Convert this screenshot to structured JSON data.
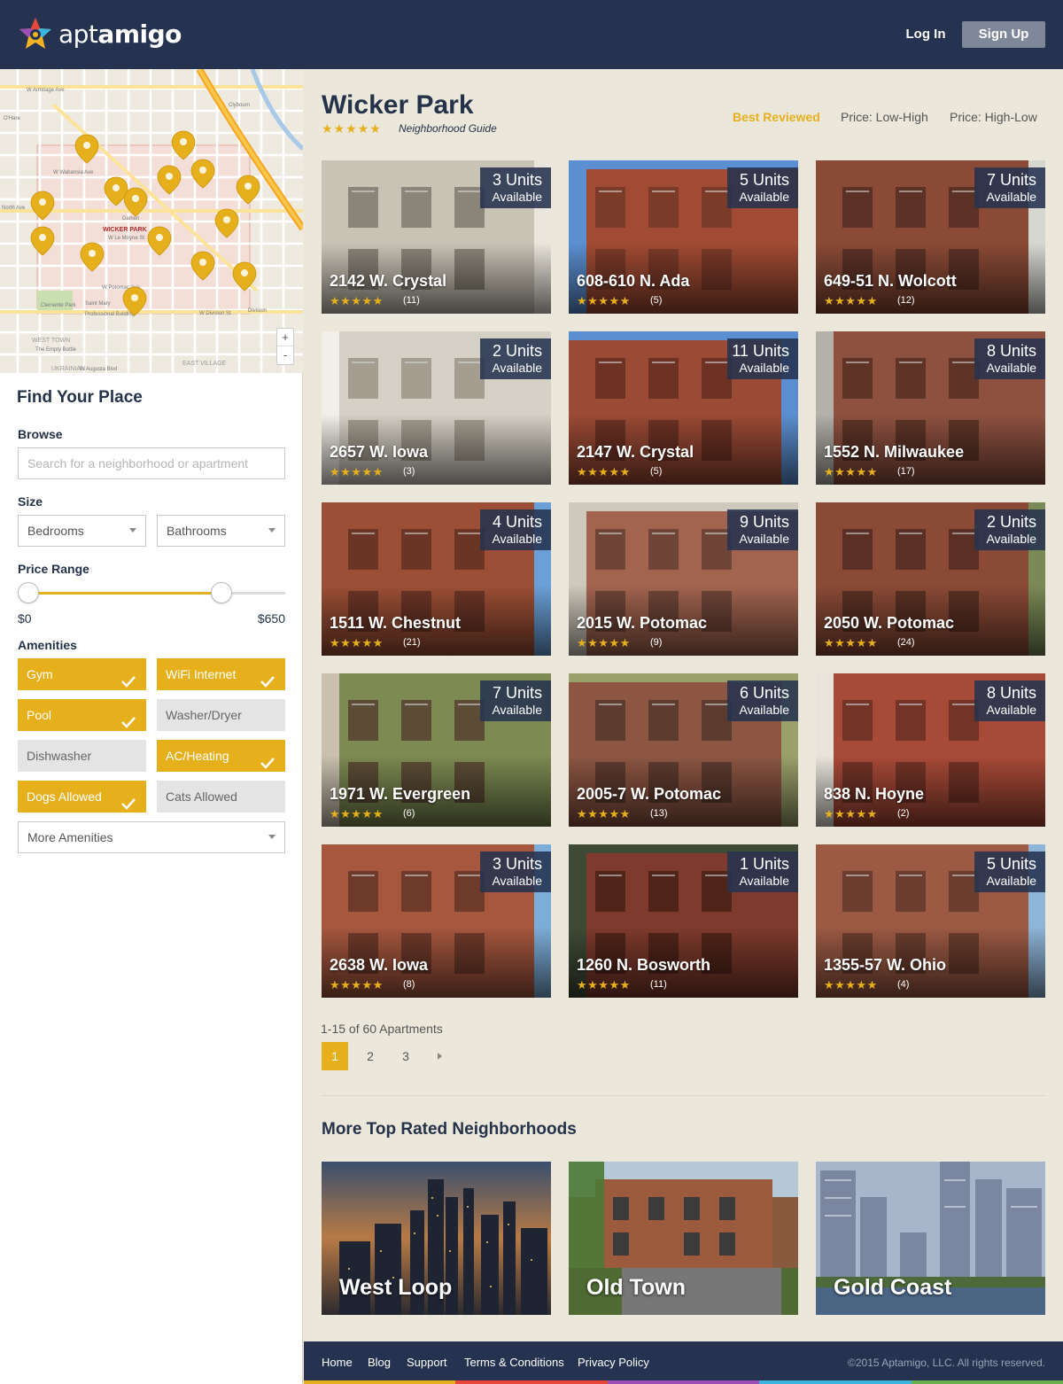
{
  "header": {
    "brand_part1": "apt",
    "brand_part2": "amigo",
    "login_label": "Log In",
    "signup_label": "Sign Up"
  },
  "sidebar": {
    "title": "Find Your Place",
    "browse_label": "Browse",
    "search_placeholder": "Search for a neighborhood or apartment",
    "size_label": "Size",
    "bedrooms_label": "Bedrooms",
    "bathrooms_label": "Bathrooms",
    "price_label": "Price Range",
    "price_min": "$0",
    "price_max": "$650",
    "price_range_selected_fraction": [
      0.04,
      0.76
    ],
    "amenities_label": "Amenities",
    "amenities": [
      {
        "label": "Gym",
        "checked": true
      },
      {
        "label": "WiFi Internet",
        "checked": true
      },
      {
        "label": "Pool",
        "checked": true
      },
      {
        "label": "Washer/Dryer",
        "checked": false
      },
      {
        "label": "Dishwasher",
        "checked": false
      },
      {
        "label": "AC/Heating",
        "checked": true
      },
      {
        "label": "Dogs Allowed",
        "checked": true
      },
      {
        "label": "Cats Allowed",
        "checked": false
      }
    ],
    "more_amenities_label": "More Amenities",
    "map": {
      "zoom_in": "+",
      "zoom_out": "-",
      "labels": {
        "wicker_park": "WICKER PARK",
        "west_town": "WEST TOWN",
        "east_village": "EAST VILLAGE",
        "ukrainian": "UKRAINIAN",
        "north_ave": "North Ave",
        "division": "Division",
        "armitage": "W Armitage Ave",
        "augusta": "W Augusta Blvd",
        "division_st": "W Division St",
        "potomac": "W Potomac Ave",
        "wabansia": "W Wabansia Ave",
        "le_moyne": "W Le Moyne St",
        "clybourn": "Clybourn",
        "ohare": "O'Hare",
        "damen": "Damen",
        "saint_mary": "Saint Mary",
        "professional_building": "Professional Building",
        "clemente_park": "Clemente Park",
        "the_empty_bottle": "The Empty Bottle"
      }
    }
  },
  "main": {
    "neighborhood": "Wicker Park",
    "rating_stars": "★★★★★",
    "subtitle": "Neighborhood Guide",
    "sort_options": [
      "Best Reviewed",
      "Price: Low-High",
      "Price: High-Low"
    ],
    "units_word": "Available",
    "listings": [
      {
        "units": "3 Units",
        "address": "2142 W. Crystal",
        "reviews": "(11)"
      },
      {
        "units": "5 Units",
        "address": "608-610 N. Ada",
        "reviews": "(5)"
      },
      {
        "units": "7 Units",
        "address": "649-51 N. Wolcott",
        "reviews": "(12)"
      },
      {
        "units": "2 Units",
        "address": "2657 W. Iowa",
        "reviews": "(3)"
      },
      {
        "units": "11 Units",
        "address": "2147 W. Crystal",
        "reviews": "(5)"
      },
      {
        "units": "8 Units",
        "address": "1552 N. Milwaukee",
        "reviews": "(17)"
      },
      {
        "units": "4 Units",
        "address": "1511 W. Chestnut",
        "reviews": "(21)"
      },
      {
        "units": "9 Units",
        "address": "2015 W. Potomac",
        "reviews": "(9)"
      },
      {
        "units": "2 Units",
        "address": "2050 W. Potomac",
        "reviews": "(24)"
      },
      {
        "units": "7 Units",
        "address": "1971 W. Evergreen",
        "reviews": "(6)"
      },
      {
        "units": "6 Units",
        "address": "2005-7 W. Potomac",
        "reviews": "(13)"
      },
      {
        "units": "8 Units",
        "address": "838 N. Hoyne",
        "reviews": "(2)"
      },
      {
        "units": "3 Units",
        "address": "2638 W. Iowa",
        "reviews": "(8)"
      },
      {
        "units": "1 Units",
        "address": "1260 N. Bosworth",
        "reviews": "(11)"
      },
      {
        "units": "5 Units",
        "address": "1355-57 W. Ohio",
        "reviews": "(4)"
      }
    ],
    "count_text": "1-15 of 60 Apartments",
    "pages": [
      "1",
      "2",
      "3"
    ],
    "active_page": "1",
    "more_title": "More Top Rated Neighborhoods",
    "more_neighborhoods": [
      "West Loop",
      "Old Town",
      "Gold Coast"
    ]
  },
  "footer": {
    "links": [
      "Home",
      "Blog",
      "Support",
      "Terms & Conditions",
      "Privacy Policy"
    ],
    "copyright": "©2015 Aptamigo, LLC. All rights reserved."
  },
  "colors": {
    "navy": "#253350",
    "accent": "#e6b01c",
    "background": "#ebe7da"
  }
}
